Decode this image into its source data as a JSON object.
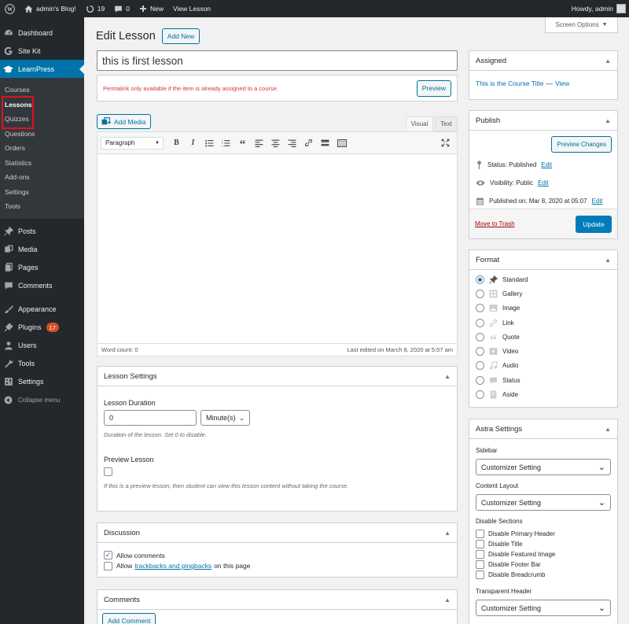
{
  "adminbar": {
    "site_name": "admin's Blog!",
    "updates_count": "19",
    "comments_count": "0",
    "new_label": "New",
    "view_label": "View Lesson",
    "howdy": "Howdy, admin"
  },
  "sidebar": {
    "dashboard": "Dashboard",
    "site_kit": "Site Kit",
    "learnpress": "LearnPress",
    "sub": [
      "Courses",
      "Lessons",
      "Quizzes",
      "Questions",
      "Orders",
      "Statistics",
      "Add-ons",
      "Settings",
      "Tools"
    ],
    "posts": "Posts",
    "media": "Media",
    "pages": "Pages",
    "comments": "Comments",
    "appearance": "Appearance",
    "plugins": "Plugins",
    "plugins_badge": "17",
    "users": "Users",
    "tools": "Tools",
    "settings": "Settings",
    "collapse": "Collapse menu"
  },
  "header": {
    "title": "Edit Lesson",
    "add_new": "Add New",
    "screen_options": "Screen Options"
  },
  "post": {
    "title_value": "this is first lesson",
    "permalink_notice": "Permalink only available if the item is already assigned to a course.",
    "preview": "Preview"
  },
  "editor": {
    "add_media": "Add Media",
    "tab_visual": "Visual",
    "tab_text": "Text",
    "format": "Paragraph",
    "word_count": "Word count: 0",
    "last_edited": "Last edited on March 8, 2020 at 5:07 am"
  },
  "lesson_settings": {
    "title": "Lesson Settings",
    "duration_label": "Lesson Duration",
    "duration_value": "0",
    "duration_unit": "Minute(s)",
    "duration_desc": "Duration of the lesson. Set 0 to disable.",
    "preview_label": "Preview Lesson",
    "preview_desc": "If this is a preview lesson, then student can view this lesson content without taking the course."
  },
  "discussion": {
    "title": "Discussion",
    "allow_comments": "Allow comments",
    "allow_prefix": "Allow",
    "trackbacks_link": "trackbacks and pingbacks",
    "allow_suffix": "on this page"
  },
  "comments_box": {
    "title": "Comments",
    "add_comment": "Add Comment"
  },
  "assigned": {
    "title": "Assigned",
    "course_title": "This is the Course Title",
    "dash": "—",
    "view": "View"
  },
  "publish": {
    "title": "Publish",
    "preview_changes": "Preview Changes",
    "status": "Status: Published",
    "visibility": "Visibility: Public",
    "published_on": "Published on: Mar 8, 2020 at 05:07",
    "edit": "Edit",
    "move_to_trash": "Move to Trash",
    "update": "Update"
  },
  "format": {
    "title": "Format",
    "options": [
      "Standard",
      "Gallery",
      "Image",
      "Link",
      "Quote",
      "Video",
      "Audio",
      "Status",
      "Aside"
    ],
    "selected": "Standard"
  },
  "astra": {
    "title": "Astra Settings",
    "sidebar_label": "Sidebar",
    "sidebar_value": "Customizer Setting",
    "content_layout_label": "Content Layout",
    "content_layout_value": "Customizer Setting",
    "disable_sections_label": "Disable Sections",
    "disable_options": [
      "Disable Primary Header",
      "Disable Title",
      "Disable Featured Image",
      "Disable Footer Bar",
      "Disable Breadcrumb"
    ],
    "transparent_header_label": "Transparent Header",
    "transparent_header_value": "Customizer Setting"
  },
  "colors": {
    "admin_dark": "#23282d",
    "accent_blue": "#0073aa",
    "highlight_red": "#e0121e"
  }
}
